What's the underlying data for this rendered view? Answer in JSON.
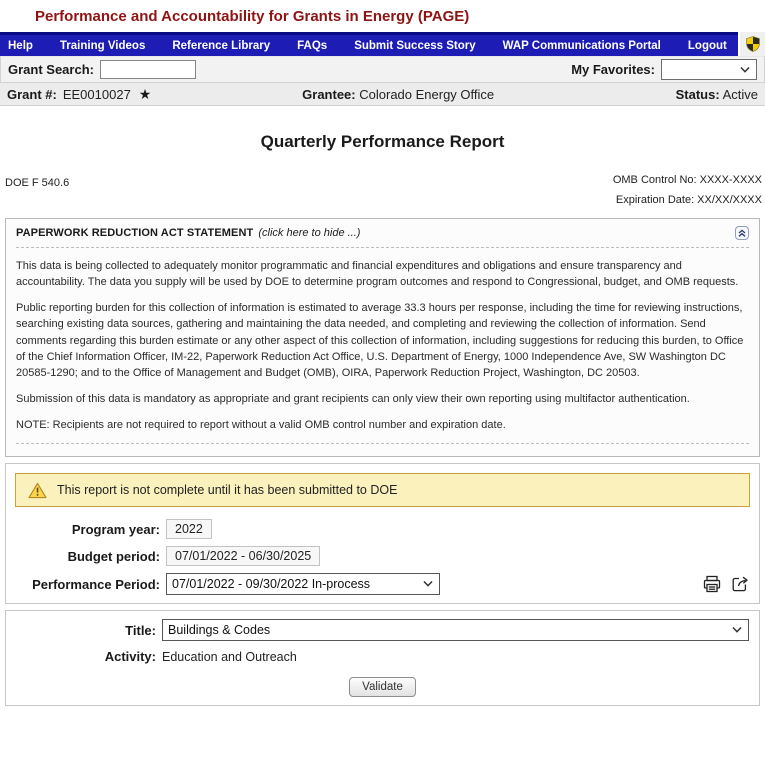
{
  "app": {
    "title": "Performance and Accountability for Grants in Energy (PAGE)"
  },
  "nav": {
    "items": [
      {
        "label": "Help"
      },
      {
        "label": "Training Videos"
      },
      {
        "label": "Reference Library"
      },
      {
        "label": "FAQs"
      },
      {
        "label": "Submit Success Story"
      },
      {
        "label": "WAP Communications Portal"
      },
      {
        "label": "Logout"
      }
    ]
  },
  "search_bar": {
    "grant_search_label": "Grant Search:",
    "grant_search_value": "",
    "my_favorites_label": "My Favorites:",
    "my_favorites_value": ""
  },
  "grant_bar": {
    "grant_label": "Grant #:",
    "grant_number": "EE0010027",
    "favorite_star": "★",
    "grantee_label": "Grantee:",
    "grantee_value": "Colorado Energy Office",
    "status_label": "Status:",
    "status_value": "Active"
  },
  "report": {
    "heading": "Quarterly Performance Report",
    "form_number": "DOE F 540.6",
    "omb_control": "OMB Control No: XXXX-XXXX",
    "expiration": "Expiration Date: XX/XX/XXXX"
  },
  "pra": {
    "title": "PAPERWORK REDUCTION ACT STATEMENT",
    "toggle_hint": "(click here to hide ...)",
    "paragraphs": [
      "This data is being collected to adequately monitor programmatic and financial expenditures and obligations and ensure transparency and accountability. The data you supply will be used by DOE to determine program outcomes and respond to Congressional, budget, and OMB requests.",
      "Public reporting burden for this collection of information is estimated to average 33.3 hours per response, including the time for reviewing instructions, searching existing data sources, gathering and maintaining the data needed, and completing and reviewing the collection of information. Send comments regarding this burden estimate or any other aspect of this collection of information, including suggestions for reducing this burden, to Office of the Chief Information Officer, IM-22, Paperwork Reduction Act Office, U.S. Department of Energy, 1000 Independence Ave, SW Washington DC 20585-1290; and to the Office of Management and Budget (OMB), OIRA, Paperwork Reduction Project, Washington, DC 20503.",
      "Submission of this data is mandatory as appropriate and grant recipients can only view their own reporting using multifactor authentication.",
      "NOTE: Recipients are not required to report without a valid OMB control number and expiration date."
    ]
  },
  "report_panel": {
    "warning": "This report is not complete until it has been submitted to DOE",
    "program_year_label": "Program year:",
    "program_year_value": "2022",
    "budget_period_label": "Budget period:",
    "budget_period_value": "07/01/2022 - 06/30/2025",
    "performance_period_label": "Performance Period:",
    "performance_period_value": "07/01/2022 - 09/30/2022 In-process"
  },
  "activity_panel": {
    "title_label": "Title:",
    "title_value": "Buildings & Codes",
    "activity_label": "Activity:",
    "activity_value": "Education and Outreach",
    "validate_button": "Validate"
  },
  "icons": {
    "security_shield": "shield",
    "collapse": "double-chevron-up",
    "warning": "warning-triangle",
    "print": "printer",
    "export": "open-external",
    "favorite": "star",
    "dropdown": "chevron-down"
  },
  "colors": {
    "title_maroon": "#8e1414",
    "nav_blue": "#1d1db5",
    "warning_bg": "#fbf1bd",
    "warning_border": "#c8a43c"
  }
}
